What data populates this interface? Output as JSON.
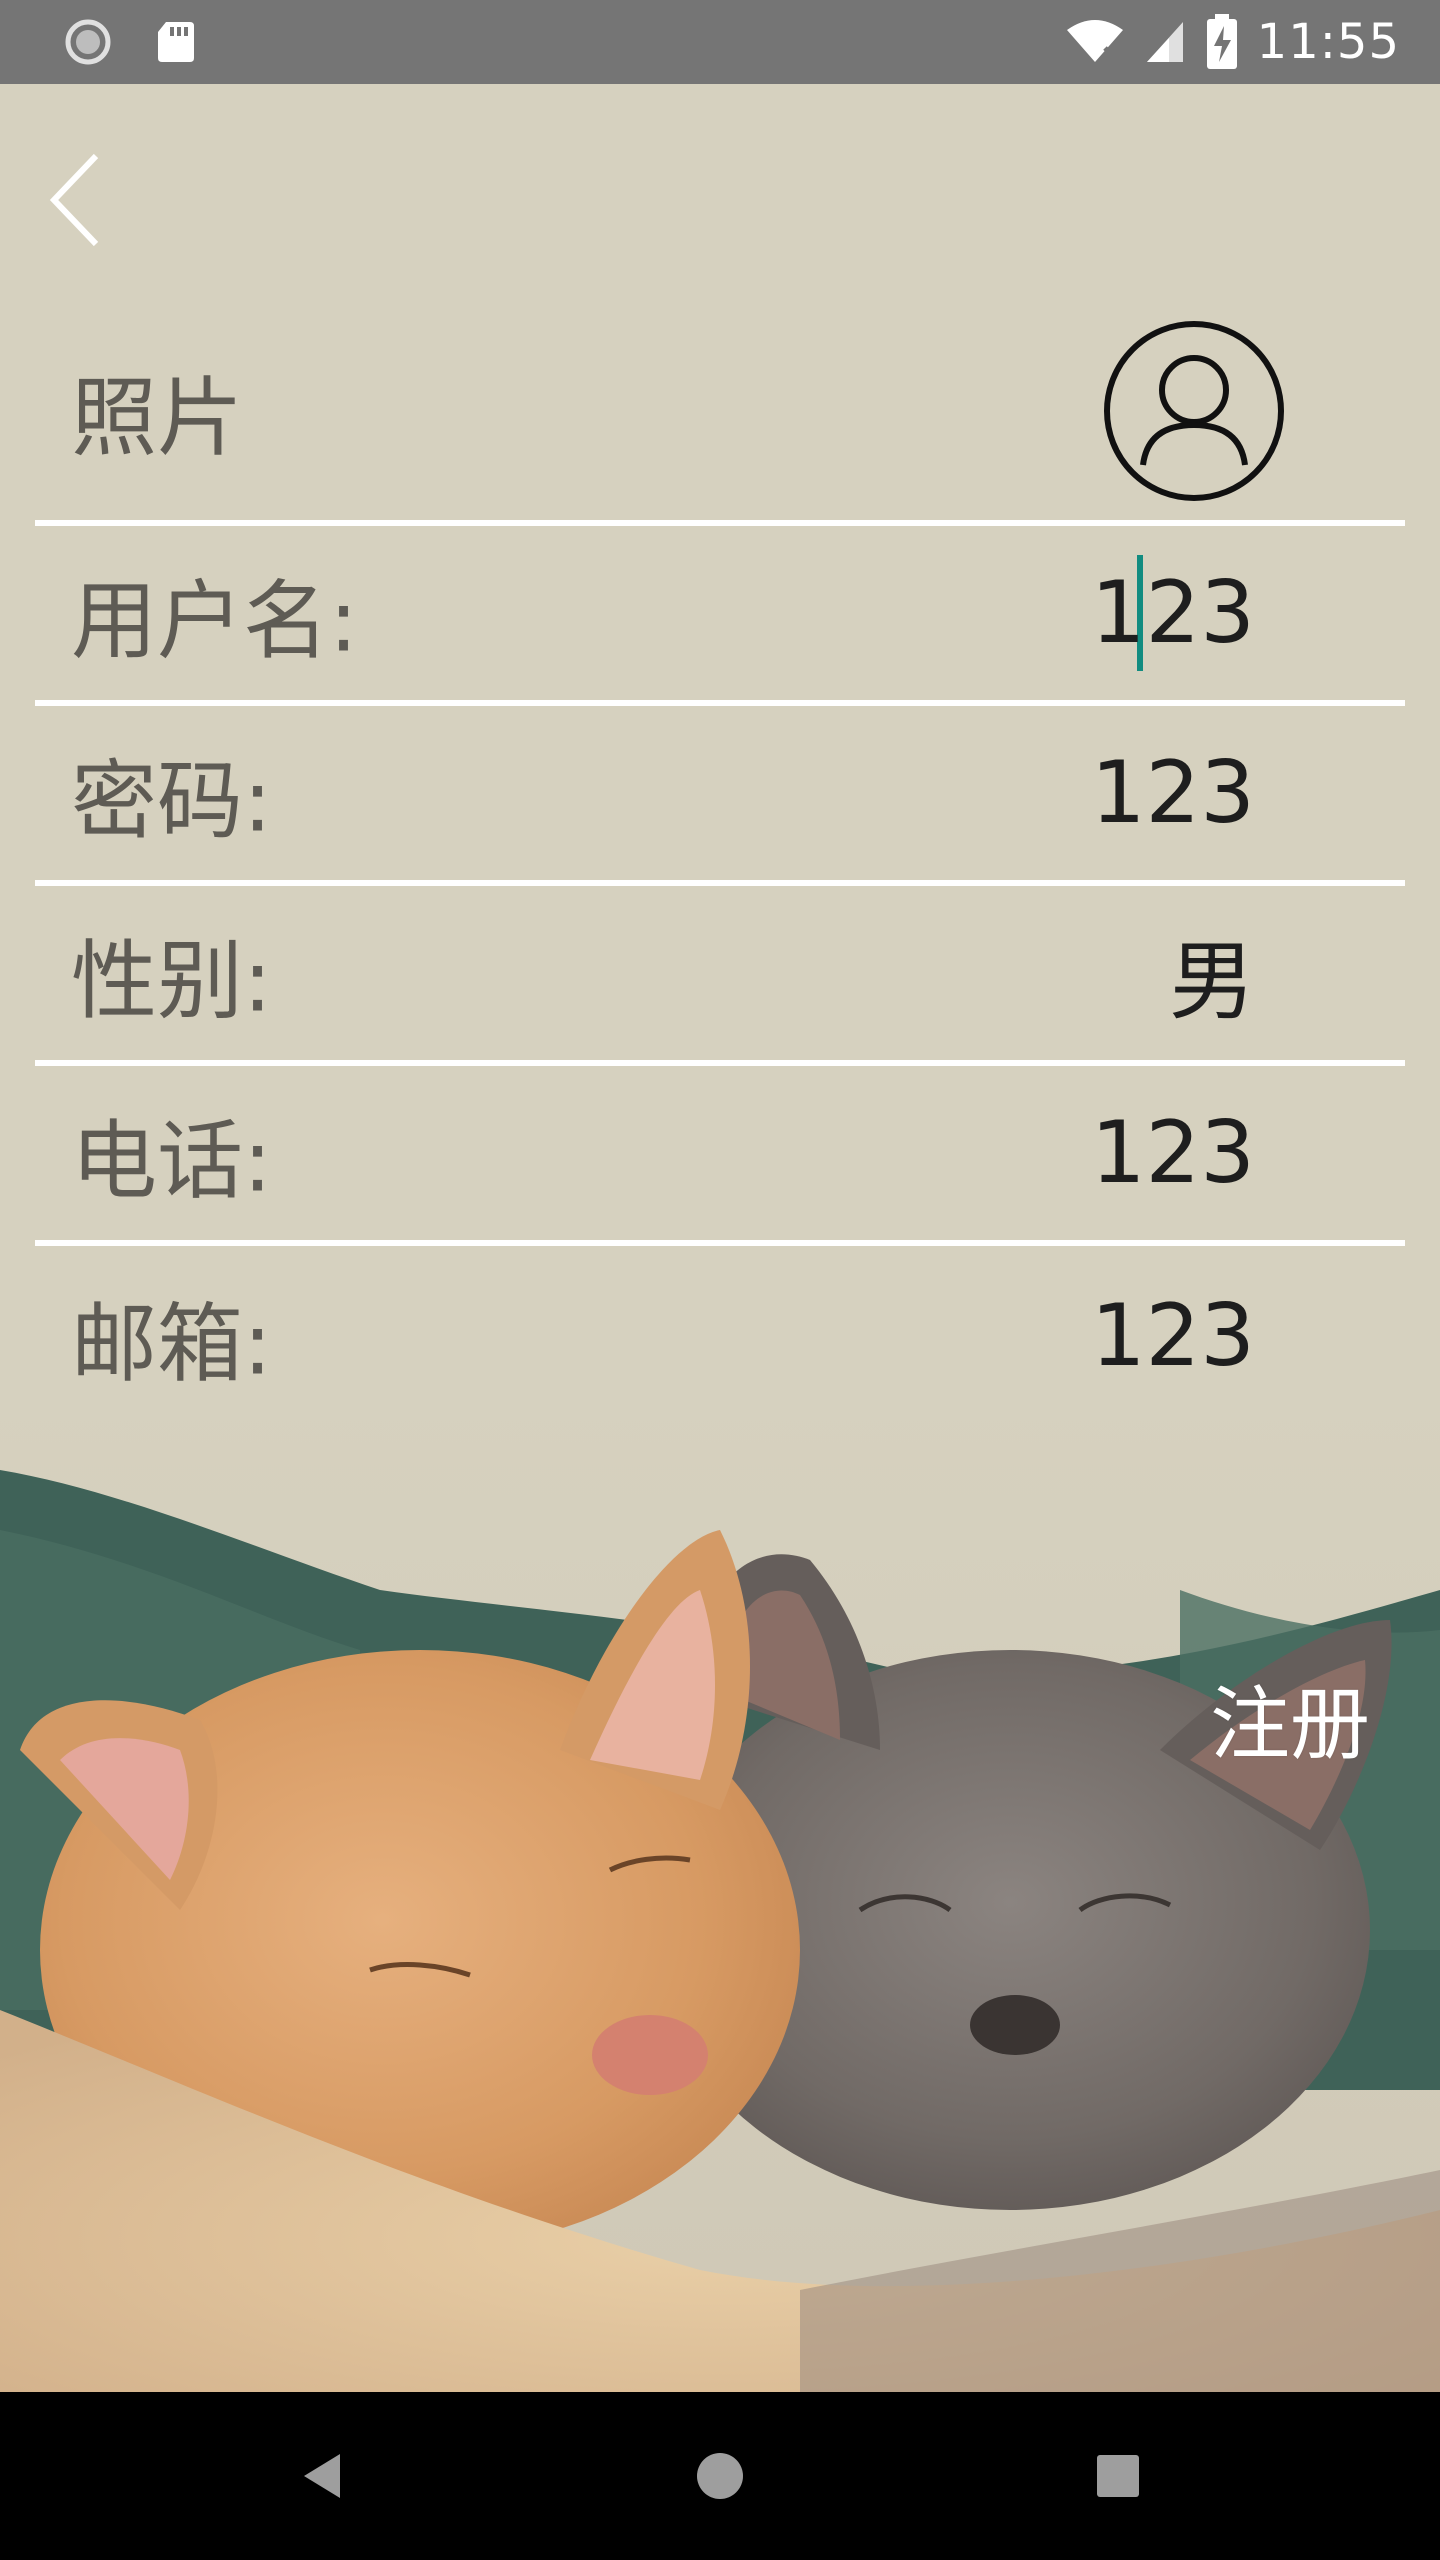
{
  "status_bar": {
    "time": "11:55",
    "icons": [
      "sync-icon",
      "sd-card-icon",
      "wifi-off-icon",
      "signal-icon",
      "battery-charging-icon"
    ]
  },
  "header": {
    "back_icon": "chevron-left-icon"
  },
  "form": {
    "photo": {
      "label": "照片",
      "avatar_icon": "user-avatar-icon"
    },
    "username": {
      "label": "用户名:",
      "value": "123"
    },
    "password": {
      "label": "密码:",
      "value": "123"
    },
    "gender": {
      "label": "性别:",
      "value": "男"
    },
    "phone": {
      "label": "电话:",
      "value": "123"
    },
    "email": {
      "label": "邮箱:",
      "value": "123"
    }
  },
  "register": {
    "label": "注册"
  },
  "nav_bar": {
    "icons": [
      "back-triangle-icon",
      "home-circle-icon",
      "recents-square-icon"
    ]
  },
  "colors": {
    "background": "#d6d1bf",
    "status_bar": "#757575",
    "divider": "#ffffff",
    "cursor": "#128c80",
    "label": "#5e5b54",
    "value": "#1e1e1e"
  }
}
